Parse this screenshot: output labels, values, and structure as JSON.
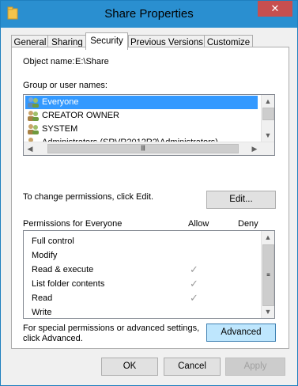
{
  "window": {
    "title": "Share Properties",
    "close_glyph": "✕"
  },
  "tabs": [
    {
      "label": "General",
      "active": false
    },
    {
      "label": "Sharing",
      "active": false
    },
    {
      "label": "Security",
      "active": true
    },
    {
      "label": "Previous Versions",
      "active": false
    },
    {
      "label": "Customize",
      "active": false
    }
  ],
  "object": {
    "label": "Object name:",
    "value": "E:\\Share"
  },
  "groups": {
    "label": "Group or user names:",
    "items": [
      {
        "name": "Everyone",
        "selected": true
      },
      {
        "name": "CREATOR OWNER",
        "selected": false
      },
      {
        "name": "SYSTEM",
        "selected": false
      },
      {
        "name": "Administrators (SRVR2012R2\\Administrators)",
        "selected": false
      }
    ]
  },
  "change_permissions": {
    "text": "To change permissions, click Edit.",
    "edit_label": "Edit..."
  },
  "permissions": {
    "header": "Permissions for Everyone",
    "allow_label": "Allow",
    "deny_label": "Deny",
    "check_glyph": "✓",
    "items": [
      {
        "name": "Full control",
        "allow": false,
        "deny": false
      },
      {
        "name": "Modify",
        "allow": false,
        "deny": false
      },
      {
        "name": "Read & execute",
        "allow": true,
        "deny": false
      },
      {
        "name": "List folder contents",
        "allow": true,
        "deny": false
      },
      {
        "name": "Read",
        "allow": true,
        "deny": false
      },
      {
        "name": "Write",
        "allow": false,
        "deny": false
      }
    ]
  },
  "advanced": {
    "text_line1": "For special permissions or advanced settings,",
    "text_line2": "click Advanced.",
    "button_label": "Advanced"
  },
  "footer": {
    "ok_label": "OK",
    "cancel_label": "Cancel",
    "apply_label": "Apply"
  },
  "colors": {
    "title_bar": "#2a8fd0",
    "close_button": "#c74f4f",
    "selection": "#3399ff",
    "focused_button": "#bee6fd"
  }
}
